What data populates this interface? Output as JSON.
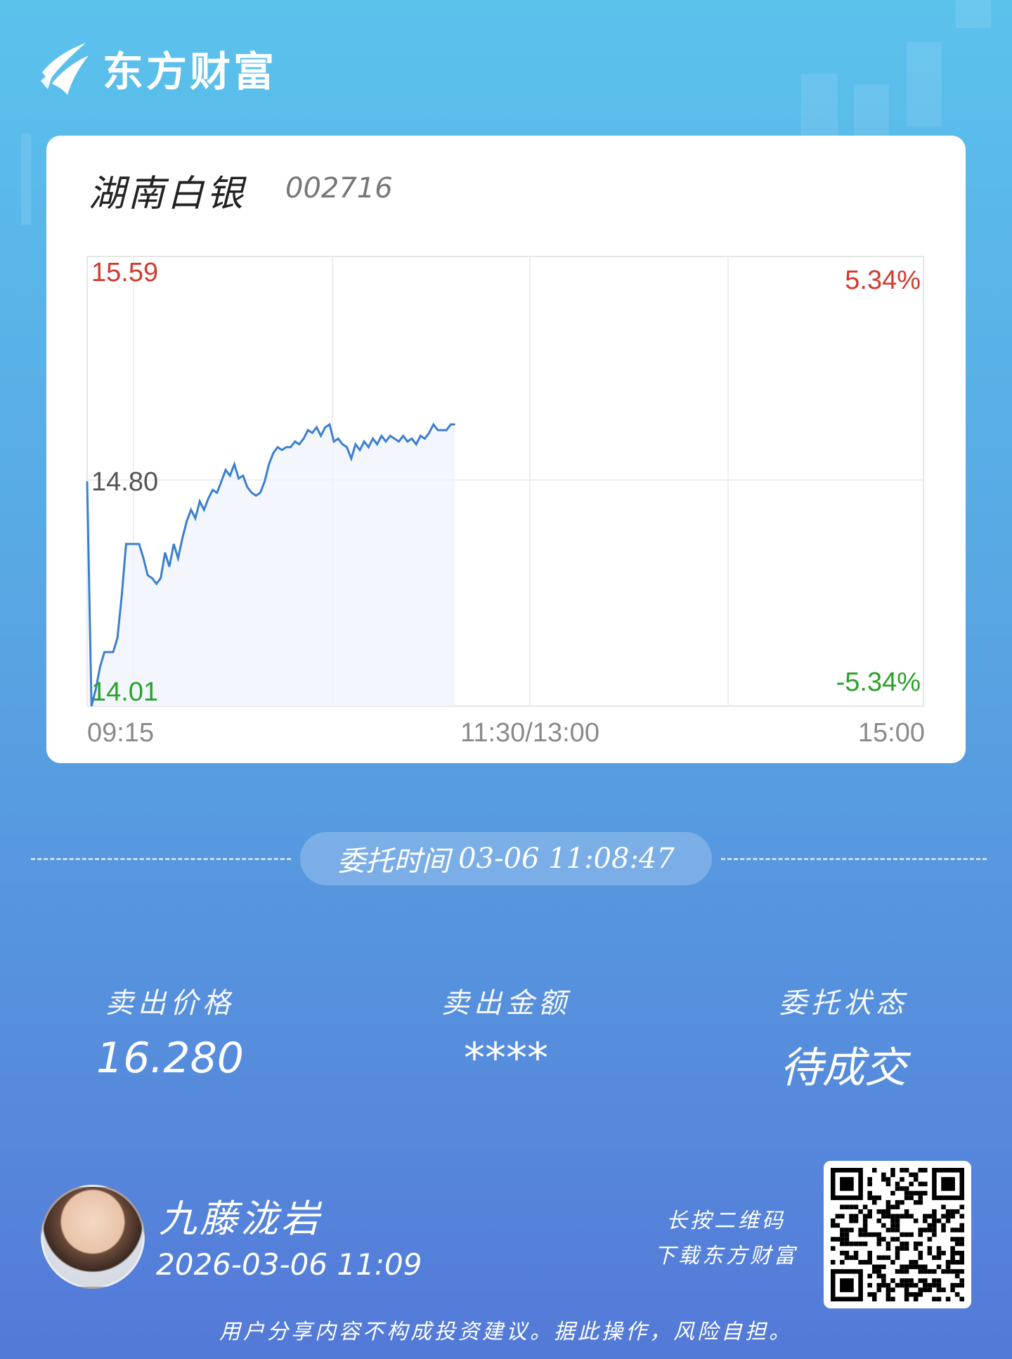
{
  "brand": {
    "name": "东方财富"
  },
  "stock": {
    "name": "湖南白银",
    "code": "002716"
  },
  "chart_data": {
    "type": "line",
    "title": "",
    "x_ticks": [
      "09:15",
      "11:30/13:00",
      "15:00"
    ],
    "y_top_label": "15.59",
    "y_mid_label": "14.80",
    "y_bottom_label": "14.01",
    "pct_top_label": "5.34%",
    "pct_bottom_label": "-5.34%",
    "ylim": [
      14.01,
      15.59
    ],
    "reference_price": 14.8,
    "series": [
      {
        "values": [
          14.8,
          14.01,
          14.07,
          14.15,
          14.2,
          14.2,
          14.2,
          14.25,
          14.4,
          14.58,
          14.58,
          14.58,
          14.58,
          14.53,
          14.47,
          14.46,
          14.44,
          14.46,
          14.55,
          14.5,
          14.58,
          14.53,
          14.6,
          14.66,
          14.7,
          14.67,
          14.73,
          14.7,
          14.74,
          14.77,
          14.76,
          14.8,
          14.84,
          14.82,
          14.86,
          14.81,
          14.82,
          14.78,
          14.76,
          14.75,
          14.76,
          14.8,
          14.86,
          14.9,
          14.92,
          14.91,
          14.92,
          14.92,
          14.94,
          14.93,
          14.95,
          14.98,
          14.97,
          14.99,
          14.96,
          14.99,
          15.0,
          14.94,
          14.95,
          14.93,
          14.92,
          14.88,
          14.93,
          14.91,
          14.94,
          14.92,
          14.95,
          14.93,
          14.96,
          14.94,
          14.96,
          14.95,
          14.94,
          14.96,
          14.94,
          14.95,
          14.93,
          14.96,
          14.95,
          14.97,
          15.0,
          14.98,
          14.98,
          14.98,
          15.0,
          15.0
        ]
      }
    ],
    "line_color": "#3b7fd0",
    "up_color": "#d23a2e",
    "down_color": "#2aa12a"
  },
  "order": {
    "label": "委托时间",
    "datetime": "03-06 11:08:47"
  },
  "stats": [
    {
      "label": "卖出价格",
      "value": "16.280"
    },
    {
      "label": "卖出金额",
      "value": "****"
    },
    {
      "label": "委托状态",
      "value": "待成交"
    }
  ],
  "user": {
    "name": "九藤泷岩",
    "share_time": "2026-03-06 11:09"
  },
  "qr": {
    "hint_line1": "长按二维码",
    "hint_line2": "下载东方财富"
  },
  "disclaimer": "用户分享内容不构成投资建议。据此操作，风险自担。"
}
